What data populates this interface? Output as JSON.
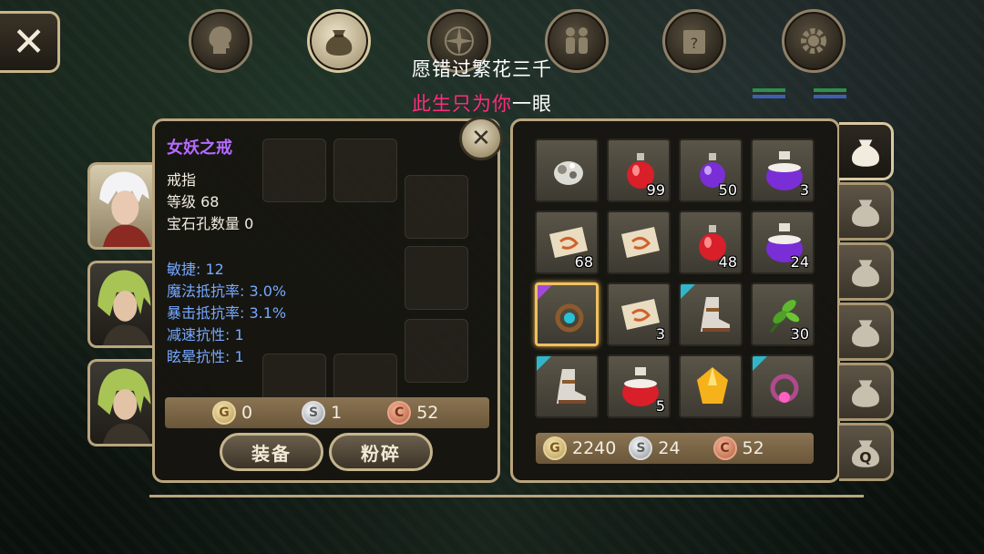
{
  "colors": {
    "panel_border": "#b9a57e",
    "item_name_purple": "#b56bff",
    "stat_blue": "#76a8ff",
    "banner_pink": "#ff2c7d",
    "rarity_cyan": "#2fb7c9",
    "rarity_purple": "#a24ad8",
    "selected_gold": "#f0c060"
  },
  "top_nav": {
    "close_icon": "close-icon",
    "buttons": [
      {
        "name": "character",
        "icon": "head-icon",
        "active": false
      },
      {
        "name": "bag",
        "icon": "bag-icon",
        "active": true
      },
      {
        "name": "skills",
        "icon": "compass-icon",
        "active": false
      },
      {
        "name": "social",
        "icon": "people-icon",
        "active": false
      },
      {
        "name": "quests",
        "icon": "scroll-icon",
        "active": false
      },
      {
        "name": "settings",
        "icon": "gear-icon",
        "active": false
      }
    ]
  },
  "banner": {
    "line1": "愿错过繁花三千",
    "line2_pink": "此生只为你",
    "line2_white": "一眼"
  },
  "item_detail": {
    "name": "女妖之戒",
    "type": "戒指",
    "level": "等级 68",
    "gem_slots": "宝石孔数量 0",
    "stats": [
      "敏捷: 12",
      "魔法抵抗率: 3.0%",
      "暴击抵抗率: 3.1%",
      "减速抗性: 1",
      "眩晕抗性: 1"
    ],
    "price": {
      "gold": "0",
      "silver": "1",
      "copper": "52"
    },
    "coin_letters": {
      "gold": "G",
      "silver": "S",
      "copper": "C"
    },
    "equip_label": "装备",
    "smash_label": "粉碎"
  },
  "inventory": {
    "slots": [
      {
        "icon": "ore-icon",
        "qty": "",
        "rarity": ""
      },
      {
        "icon": "red-potion-icon",
        "qty": "99",
        "rarity": ""
      },
      {
        "icon": "purple-potion-icon",
        "qty": "50",
        "rarity": ""
      },
      {
        "icon": "purple-potion-large-icon",
        "qty": "3",
        "rarity": ""
      },
      {
        "icon": "scroll-icon",
        "qty": "68",
        "rarity": ""
      },
      {
        "icon": "scroll-icon",
        "qty": "",
        "rarity": ""
      },
      {
        "icon": "red-potion-icon",
        "qty": "48",
        "rarity": ""
      },
      {
        "icon": "purple-potion-large-icon",
        "qty": "24",
        "rarity": ""
      },
      {
        "icon": "ring-icon",
        "qty": "",
        "rarity": "purple",
        "selected": true
      },
      {
        "icon": "scroll-icon",
        "qty": "3",
        "rarity": ""
      },
      {
        "icon": "boot-icon",
        "qty": "",
        "rarity": "cyan"
      },
      {
        "icon": "herb-icon",
        "qty": "30",
        "rarity": ""
      },
      {
        "icon": "boot-icon",
        "qty": "",
        "rarity": "cyan"
      },
      {
        "icon": "red-potion-large-icon",
        "qty": "5",
        "rarity": ""
      },
      {
        "icon": "gem-icon",
        "qty": "",
        "rarity": ""
      },
      {
        "icon": "ring-pink-icon",
        "qty": "",
        "rarity": "cyan"
      }
    ],
    "money": {
      "gold": "2240",
      "silver": "24",
      "copper": "52"
    }
  },
  "side_tabs": [
    {
      "icon": "bag-icon",
      "active": true,
      "label": ""
    },
    {
      "icon": "bag-icon",
      "active": false,
      "label": ""
    },
    {
      "icon": "bag-icon",
      "active": false,
      "label": ""
    },
    {
      "icon": "bag-icon",
      "active": false,
      "label": ""
    },
    {
      "icon": "bag-icon",
      "active": false,
      "label": ""
    },
    {
      "icon": "bag-icon",
      "active": false,
      "label": "Q"
    }
  ]
}
